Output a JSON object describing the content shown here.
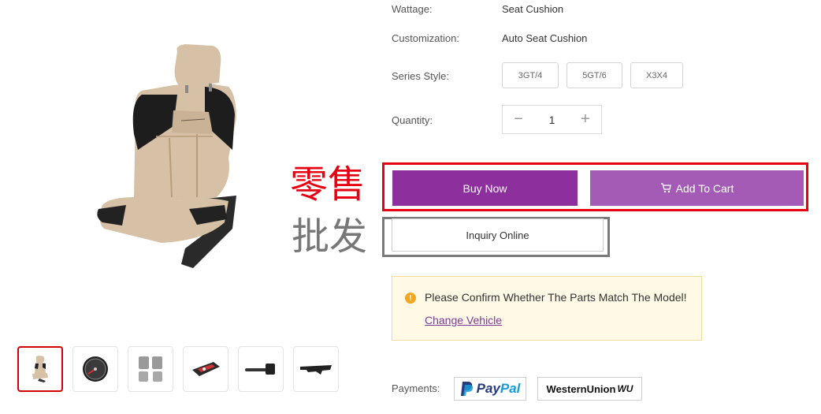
{
  "specs": {
    "wattage_label": "Wattage:",
    "wattage_value": "Seat Cushion",
    "customization_label": "Customization:",
    "customization_value": "Auto Seat Cushion",
    "series_label": "Series Style:",
    "series_options": [
      "3GT/4",
      "5GT/6",
      "X3X4"
    ],
    "quantity_label": "Quantity:",
    "quantity_value": "1",
    "minus_symbol": "−",
    "plus_symbol": "+"
  },
  "annotations": {
    "retail": "零售",
    "wholesale": "批发",
    "retail_color": "#e60012",
    "wholesale_color": "#777777"
  },
  "actions": {
    "buy_now": "Buy Now",
    "add_to_cart": "Add To Cart",
    "inquiry": "Inquiry Online",
    "buy_color": "#8e2f9e",
    "cart_color": "#a35bb6"
  },
  "notice": {
    "message": "Please Confirm Whether The Parts Match The Model!",
    "link": "Change Vehicle"
  },
  "payments": {
    "label": "Payments:",
    "paypal_pay": "Pay",
    "paypal_pal": "Pal",
    "western_union": "WesternUnion",
    "wu_mark": "WU"
  },
  "thumbnails": [
    {
      "name": "car-seat",
      "active": true
    },
    {
      "name": "speedometer-gauge",
      "active": false
    },
    {
      "name": "floor-mats",
      "active": false
    },
    {
      "name": "control-module",
      "active": false
    },
    {
      "name": "turn-signal-switch",
      "active": false
    },
    {
      "name": "dashboard-bracket",
      "active": false
    }
  ]
}
